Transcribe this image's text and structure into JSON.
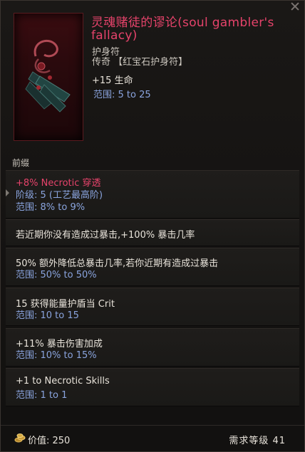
{
  "item": {
    "name": "灵魂赌徒的谬论(soul gambler's fallacy)",
    "subtype": "护身符",
    "rarity": "传奇 【红宝石护身符】",
    "implicit": {
      "value": "+15 生命",
      "range": "范围: 5 to 25"
    }
  },
  "affixes": {
    "label": "前缀",
    "rows": [
      {
        "line1": "+8% Necrotic 穿透",
        "line2": "阶级: 5 (工艺最高阶)",
        "line3": "范围: 8% to 9%"
      },
      {
        "line1": "若近期你没有造成过暴击,+100% 暴击几率"
      },
      {
        "line1": "50% 额外降低总暴击几率,若你近期有造成过暴击",
        "line2": "范围: 50% to 50%"
      },
      {
        "line1": "15 获得能量护盾当 Crit",
        "line2": "范围: 10 to 15"
      },
      {
        "line1": "+11% 暴击伤害加成",
        "line2": "范围: 10% to 15%"
      },
      {
        "line1": "+1 to Necrotic Skills",
        "line2": "范围: 1 to 1"
      }
    ]
  },
  "footer": {
    "value": "价值: 250",
    "requirement": "需求等级 41"
  },
  "colors": {
    "legendary_name": "#e6436b",
    "range_blue": "#8aa4de",
    "text_white": "#e8e3da"
  },
  "icons": {
    "close": "close-icon",
    "item": "amulet-icon",
    "coin": "coin-icon"
  }
}
